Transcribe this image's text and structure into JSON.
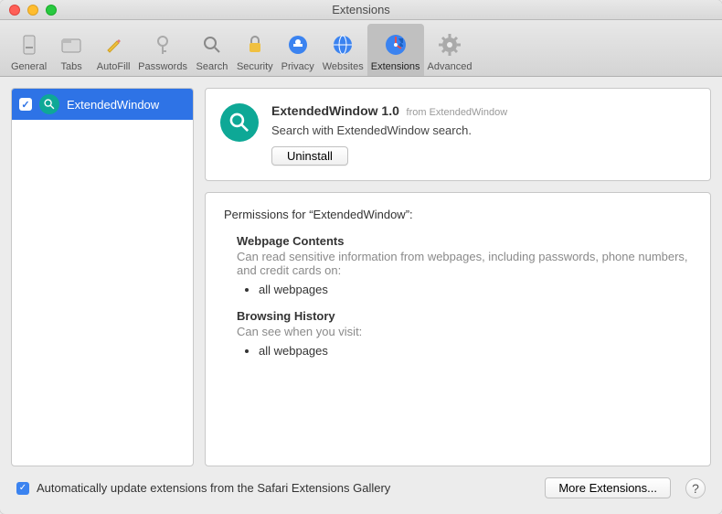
{
  "window": {
    "title": "Extensions"
  },
  "toolbar": {
    "items": [
      {
        "label": "General"
      },
      {
        "label": "Tabs"
      },
      {
        "label": "AutoFill"
      },
      {
        "label": "Passwords"
      },
      {
        "label": "Search"
      },
      {
        "label": "Security"
      },
      {
        "label": "Privacy"
      },
      {
        "label": "Websites"
      },
      {
        "label": "Extensions"
      },
      {
        "label": "Advanced"
      }
    ]
  },
  "sidebar": {
    "items": [
      {
        "name": "ExtendedWindow",
        "checked": true
      }
    ]
  },
  "details": {
    "title": "ExtendedWindow 1.0",
    "from": "from ExtendedWindow",
    "description": "Search with ExtendedWindow search.",
    "uninstall_label": "Uninstall"
  },
  "permissions": {
    "header": "Permissions for “ExtendedWindow”:",
    "sections": [
      {
        "title": "Webpage Contents",
        "desc": "Can read sensitive information from webpages, including passwords, phone numbers, and credit cards on:",
        "items": [
          "all webpages"
        ]
      },
      {
        "title": "Browsing History",
        "desc": "Can see when you visit:",
        "items": [
          "all webpages"
        ]
      }
    ]
  },
  "footer": {
    "auto_update_label": "Automatically update extensions from the Safari Extensions Gallery",
    "more_label": "More Extensions...",
    "help_label": "?"
  }
}
